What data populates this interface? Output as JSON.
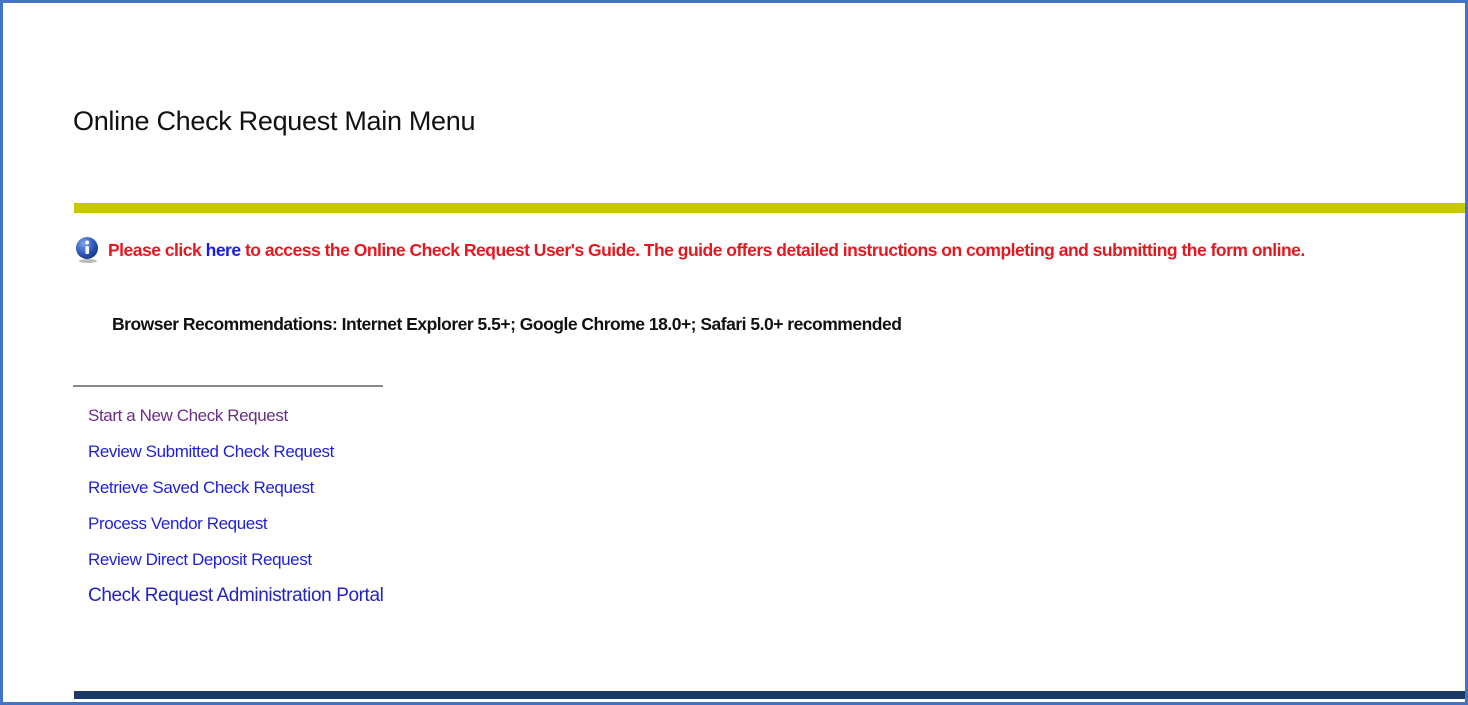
{
  "page": {
    "title": "Online Check Request Main Menu"
  },
  "info": {
    "icon": "info-icon",
    "text_before": "Please click ",
    "link_text": "here",
    "text_after": " to access the Online Check Request User's Guide. The guide offers detailed instructions on completing and submitting the form online."
  },
  "browser_recommendations": "Browser Recommendations: Internet Explorer 5.5+; Google Chrome 18.0+; Safari 5.0+ recommended",
  "menu": {
    "items": [
      {
        "label": "Start a New Check Request"
      },
      {
        "label": "Review Submitted Check Request"
      },
      {
        "label": "Retrieve Saved Check Request"
      },
      {
        "label": "Process Vendor Request"
      },
      {
        "label": "Review Direct Deposit Request"
      },
      {
        "label": "Check Request Administration Portal"
      }
    ]
  },
  "colors": {
    "frame_border": "#4472c4",
    "accent_bar": "#c8c800",
    "footer_bar": "#1a3a66",
    "notice_text": "#e8171f",
    "link": "#1f1fd8",
    "visited_link": "#6a2e8a"
  }
}
